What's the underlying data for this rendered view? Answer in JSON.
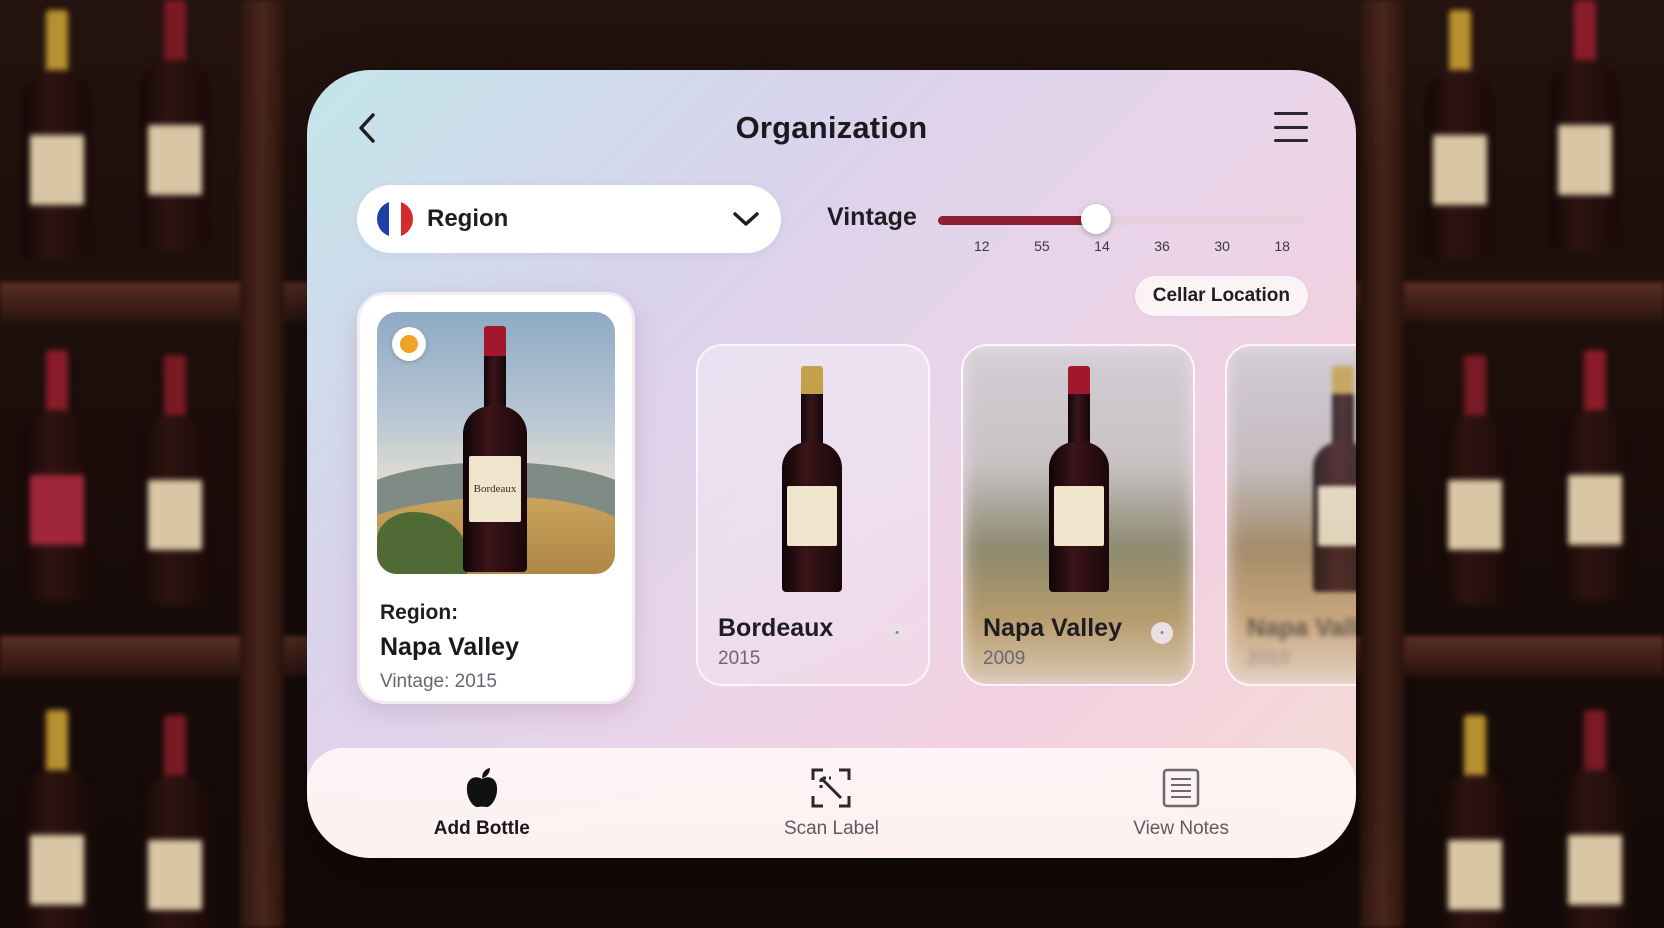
{
  "header": {
    "title": "Organization"
  },
  "filters": {
    "region_label": "Region",
    "vintage_label": "Vintage",
    "vintage_ticks": [
      "12",
      "55",
      "14",
      "36",
      "30",
      "18"
    ],
    "vintage_slider_level": 0.43,
    "cellar_location_label": "Cellar Location"
  },
  "selected_card": {
    "caption": "Region:",
    "name": "Napa Valley",
    "vintage": "Vintage: 2015",
    "bottle_label": "Bordeaux"
  },
  "cards": [
    {
      "name": "Bordeaux",
      "year": "2015"
    },
    {
      "name": "Napa Valley",
      "year": "2009"
    },
    {
      "name": "Napa Valley",
      "year": "2010"
    }
  ],
  "toolbar": {
    "add_label": "Add Bottle",
    "scan_label": "Scan Label",
    "notes_label": "View Notes"
  },
  "colors": {
    "accent": "#8e1f35",
    "flag_blue": "#1f3fa8",
    "flag_white": "#ffffff",
    "flag_red": "#d62b2b"
  },
  "icons": {
    "back": "chevron-left-icon",
    "menu": "hamburger-menu-icon",
    "dropdown": "chevron-down-icon",
    "add": "apple-icon",
    "scan": "scan-frame-icon",
    "notes": "document-lines-icon",
    "flag": "france-flag-icon"
  }
}
